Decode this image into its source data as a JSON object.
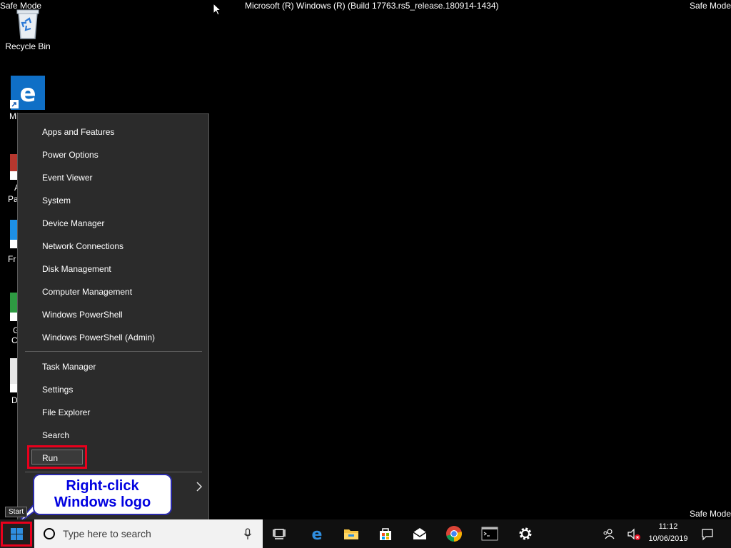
{
  "watermarks": {
    "top_left": "Safe Mode",
    "top_right": "Safe Mode",
    "bottom_right": "Safe Mode",
    "build": "Microsoft (R) Windows (R) (Build 17763.rs5_release.180914-1434)"
  },
  "desktop_icons": [
    {
      "label": "Recycle Bin",
      "icon": "recycle-bin-icon"
    },
    {
      "label": "Mi",
      "icon": "edge-icon"
    }
  ],
  "partial_labels": [
    "A",
    "Pa",
    "Fr",
    "G",
    "C",
    "D"
  ],
  "menu": {
    "items": [
      "Apps and Features",
      "Power Options",
      "Event Viewer",
      "System",
      "Device Manager",
      "Network Connections",
      "Disk Management",
      "Computer Management",
      "Windows PowerShell",
      "Windows PowerShell (Admin)",
      "Task Manager",
      "Settings",
      "File Explorer",
      "Search",
      "Run"
    ],
    "highlighted_item": "Run",
    "submenu_arrow": "chevron-right-icon"
  },
  "callout": {
    "line1": "Right-click",
    "line2": "Windows logo"
  },
  "tooltip": "Start",
  "taskbar": {
    "search_placeholder": "Type here to search",
    "pinned": [
      "task-view-icon",
      "edge-icon",
      "file-explorer-icon",
      "store-icon",
      "mail-icon",
      "chrome-icon",
      "command-prompt-icon",
      "settings-icon"
    ],
    "clock_time": "11:12",
    "clock_date": "10/06/2019"
  },
  "colors": {
    "highlight_red": "#e8001c",
    "callout_text": "#0000e0",
    "menu_bg": "#2b2b2b",
    "accent_blue": "#0078d7"
  }
}
